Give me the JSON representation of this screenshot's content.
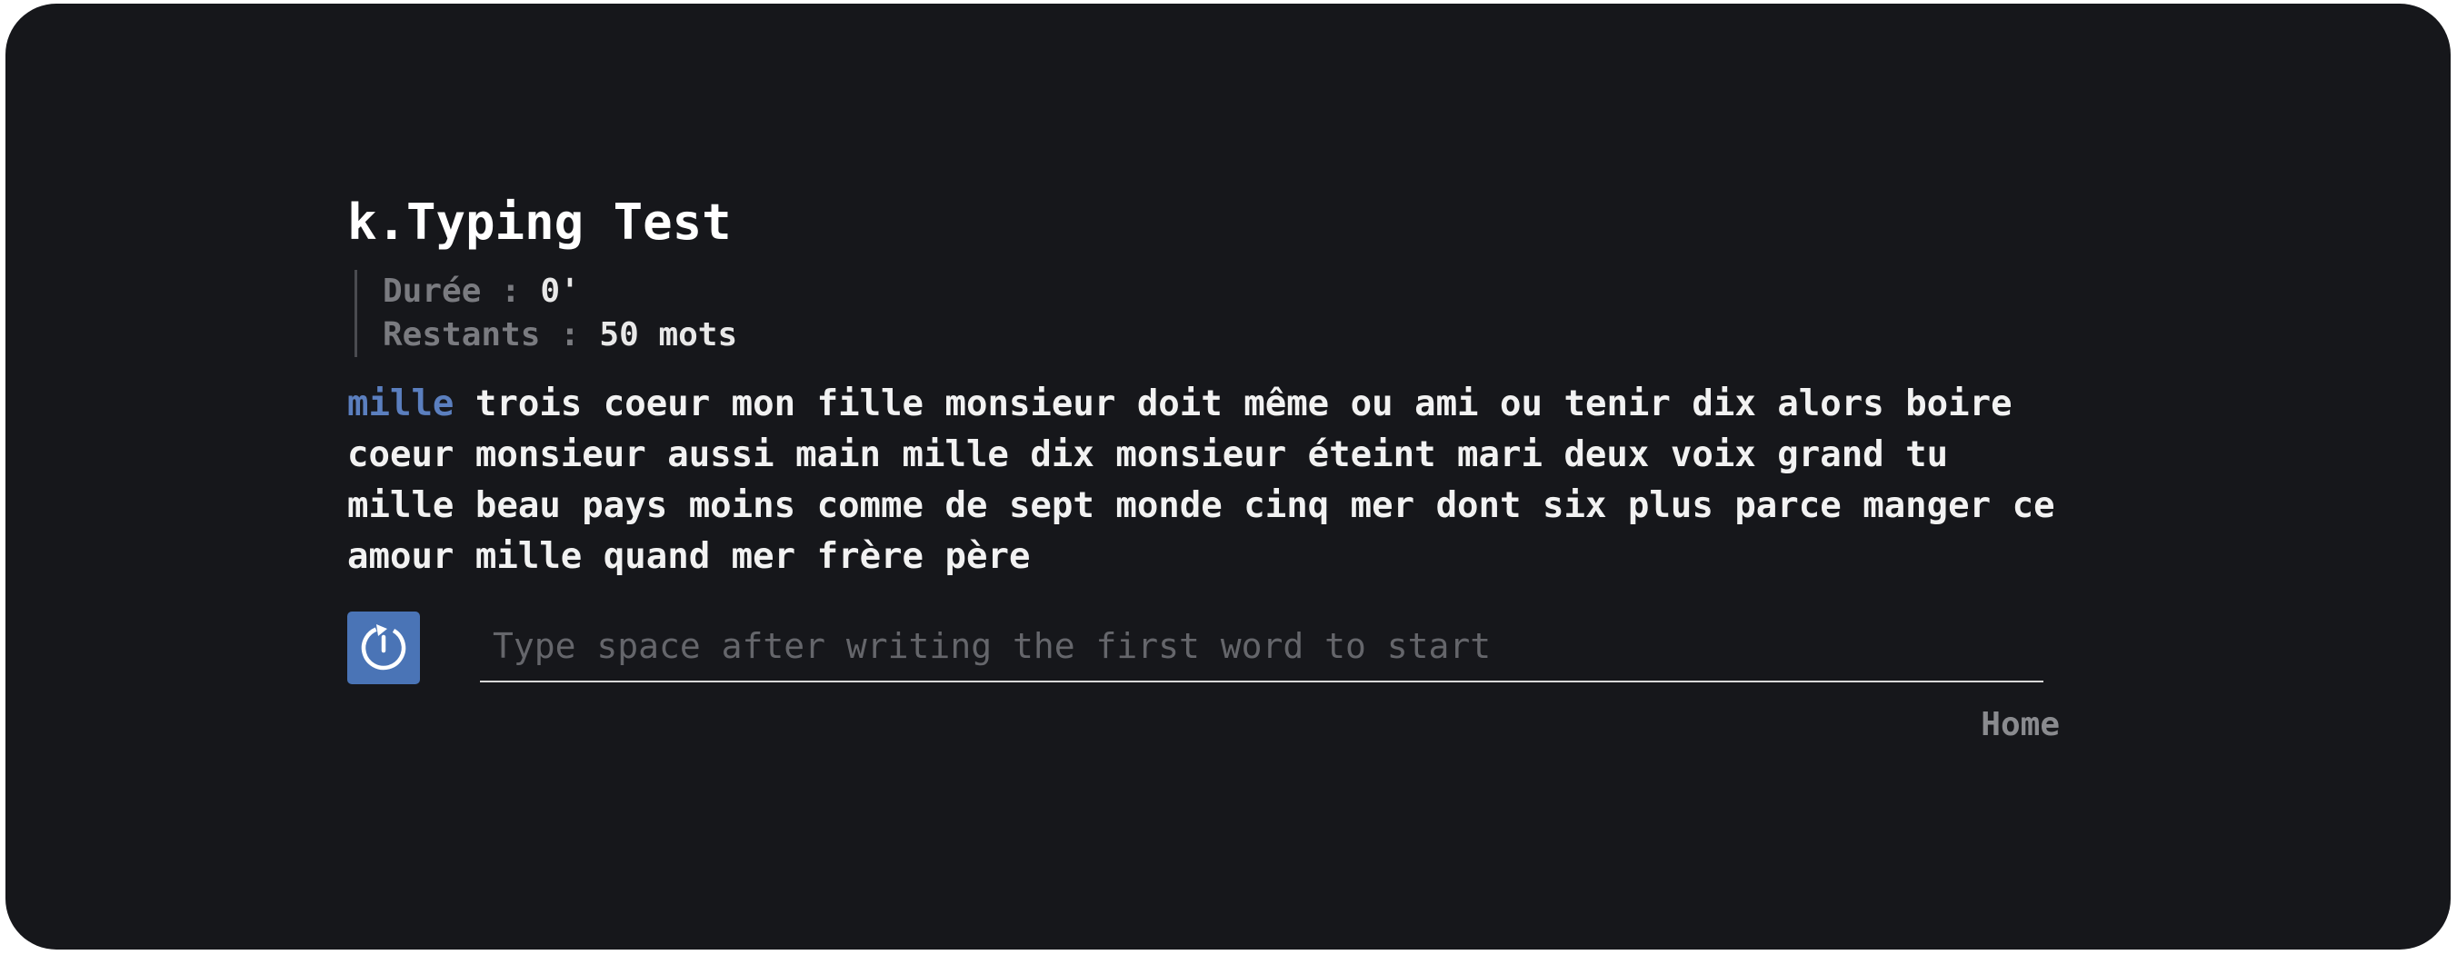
{
  "app": {
    "title": "k.Typing Test"
  },
  "stats": {
    "duration_label": "Durée : ",
    "duration_value": "0'",
    "remaining_label": "Restants : ",
    "remaining_value": "50 mots"
  },
  "words": [
    "mille",
    "trois",
    "coeur",
    "mon",
    "fille",
    "monsieur",
    "doit",
    "même",
    "ou",
    "ami",
    "ou",
    "tenir",
    "dix",
    "alors",
    "boire",
    "coeur",
    "monsieur",
    "aussi",
    "main",
    "mille",
    "dix",
    "monsieur",
    "éteint",
    "mari",
    "deux",
    "voix",
    "grand",
    "tu",
    "mille",
    "beau",
    "pays",
    "moins",
    "comme",
    "de",
    "sept",
    "monde",
    "cinq",
    "mer",
    "dont",
    "six",
    "plus",
    "parce",
    "manger",
    "ce",
    "amour",
    "mille",
    "quand",
    "mer",
    "frère",
    "père"
  ],
  "current_word_index": 0,
  "input": {
    "placeholder": "Type space after writing the first word to start",
    "value": ""
  },
  "restart_icon": "restart-icon",
  "nav": {
    "home_label": "Home"
  },
  "colors": {
    "background": "#16171b",
    "current_word": "#5b7fbf",
    "accent": "#4a74b6",
    "text": "#f2f2f2",
    "muted": "#7a7b80"
  }
}
